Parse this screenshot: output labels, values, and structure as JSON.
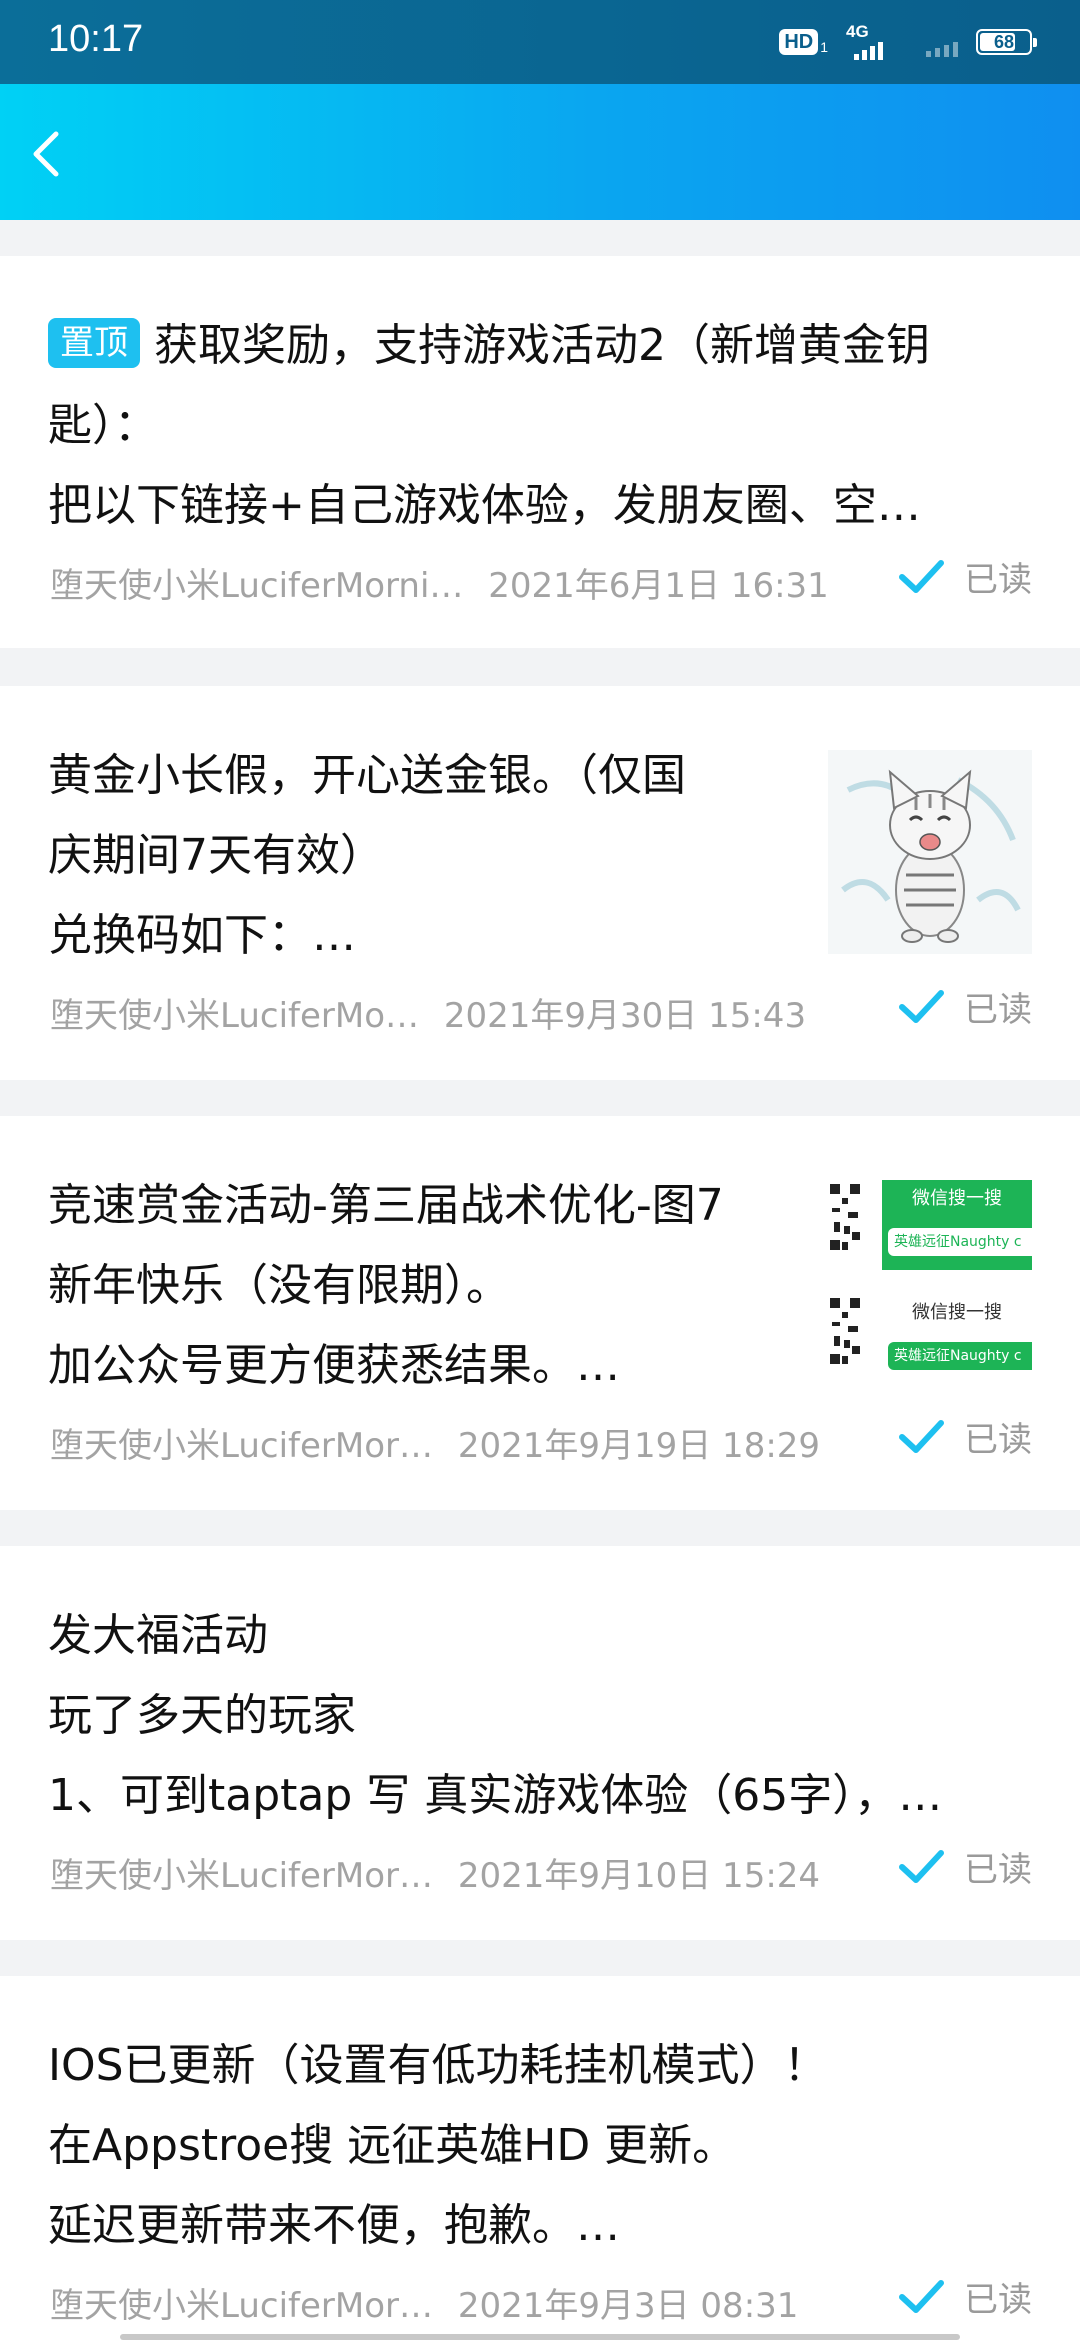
{
  "status_bar": {
    "time": "10:17",
    "hd_label": "HD",
    "hd_sub": "1",
    "network": "4G",
    "battery": "68"
  },
  "colors": {
    "status_bg": "#0a5f8c",
    "header_gradient_start": "#00d1f5",
    "header_gradient_end": "#0f8ff0",
    "accent": "#1ec0f0",
    "meta_text": "#a3a3a3"
  },
  "header": {
    "back_icon": "chevron-left-icon"
  },
  "posts": [
    {
      "pinned_label": "置顶",
      "lines": [
        "获取奖励，支持游戏活动2（新增黄金钥",
        "匙）：",
        "把以下链接+自己游戏体验，发朋友圈、空…"
      ],
      "author": "堕天使小米LuciferMorni…",
      "date": "2021年6月1日 16:31",
      "read": "已读"
    },
    {
      "lines": [
        "黄金小长假，开心送金银。（仅国",
        "庆期间7天有效）",
        "兑换码如下：…"
      ],
      "author": "堕天使小米LuciferMo…",
      "date": "2021年9月30日 15:43",
      "read": "已读",
      "thumb": "kitten-illustration"
    },
    {
      "lines": [
        "竞速赏金活动-第三届战术优化-图7",
        "新年快乐（没有限期）。",
        "加公众号更方便获悉结果。…"
      ],
      "author": "堕天使小米LuciferMor…",
      "date": "2021年9月19日 18:29",
      "read": "已读",
      "thumb_text_1": "微信搜一搜",
      "thumb_text_2": "英雄远征Naughty c",
      "thumb_text_3": "微信搜一搜",
      "thumb_text_4": "英雄远征Naughty c"
    },
    {
      "lines": [
        "发大福活动",
        "玩了多天的玩家",
        "1、可到taptap 写 真实游戏体验（65字），…"
      ],
      "author": "堕天使小米LuciferMor…",
      "date": "2021年9月10日 15:24",
      "read": "已读"
    },
    {
      "lines": [
        "IOS已更新（设置有低功耗挂机模式）！",
        "在Appstroe搜 远征英雄HD 更新。",
        "延迟更新带来不便，抱歉。…"
      ],
      "author": "堕天使小米LuciferMor…",
      "date": "2021年9月3日 08:31",
      "read": "已读"
    }
  ]
}
